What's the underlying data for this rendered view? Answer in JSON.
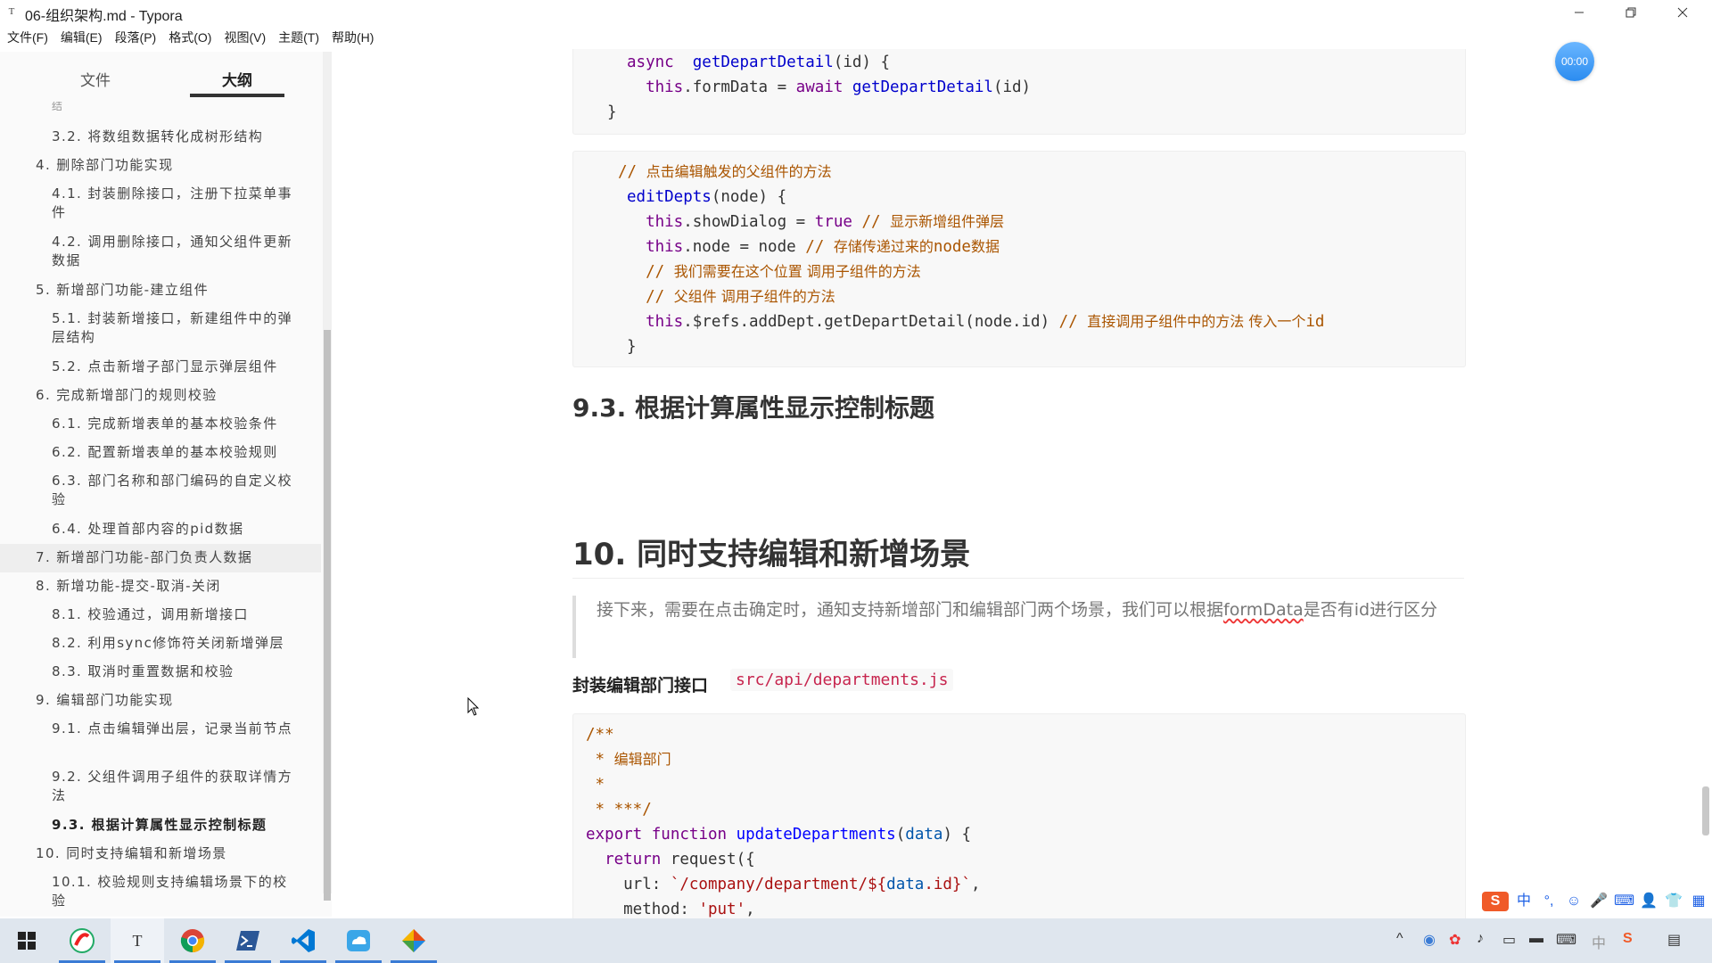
{
  "window": {
    "title": "06-组织架构.md - Typora",
    "app_icon": "T"
  },
  "menu": [
    "文件(F)",
    "编辑(E)",
    "段落(P)",
    "格式(O)",
    "视图(V)",
    "主题(T)",
    "帮助(H)"
  ],
  "sidebar": {
    "tabs": {
      "files": "文件",
      "outline": "大纲"
    },
    "outline": [
      {
        "text": "3.2. 将数组数据转化成树形结构",
        "level": 2
      },
      {
        "text": "4. 删除部门功能实现",
        "level": 1
      },
      {
        "text": "4.1. 封装删除接口，注册下拉菜单事件",
        "level": 2
      },
      {
        "text": "4.2. 调用删除接口，通知父组件更新数据",
        "level": 2
      },
      {
        "text": "5. 新增部门功能-建立组件",
        "level": 1
      },
      {
        "text": "5.1. 封装新增接口，新建组件中的弹层结构",
        "level": 2
      },
      {
        "text": "5.2. 点击新增子部门显示弹层组件",
        "level": 2
      },
      {
        "text": "6. 完成新增部门的规则校验",
        "level": 1
      },
      {
        "text": "6.1. 完成新增表单的基本校验条件",
        "level": 2
      },
      {
        "text": "6.2. 配置新增表单的基本校验规则",
        "level": 2
      },
      {
        "text": "6.3. 部门名称和部门编码的自定义校验",
        "level": 2
      },
      {
        "text": "6.4. 处理首部内容的pid数据",
        "level": 2
      },
      {
        "text": "7. 新增部门功能-部门负责人数据",
        "level": 1,
        "hover": true
      },
      {
        "text": "8. 新增功能-提交-取消-关闭",
        "level": 1
      },
      {
        "text": "8.1. 校验通过，调用新增接口",
        "level": 2
      },
      {
        "text": "8.2. 利用sync修饰符关闭新增弹层",
        "level": 2
      },
      {
        "text": "8.3. 取消时重置数据和校验",
        "level": 2
      },
      {
        "text": "9. 编辑部门功能实现",
        "level": 1
      },
      {
        "text": "9.1. 点击编辑弹出层，记录当前节点",
        "level": 2
      },
      {
        "text": "9.2. 父组件调用子组件的获取详情方法",
        "level": 2
      },
      {
        "text": "9.3. 根据计算属性显示控制标题",
        "level": 2,
        "active": true
      },
      {
        "text": "10. 同时支持编辑和新增场景",
        "level": 1
      },
      {
        "text": "10.1. 校验规则支持编辑场景下的校验",
        "level": 2
      }
    ]
  },
  "code1": [
    [
      [
        "kw",
        "async"
      ],
      [
        "",
        "  "
      ],
      [
        "fn",
        "getDepartDetail"
      ],
      [
        "",
        "(id) {"
      ]
    ],
    [
      [
        "",
        "  "
      ],
      [
        "kw",
        "this"
      ],
      [
        "",
        ".formData = "
      ],
      [
        "kw",
        "await"
      ],
      [
        "",
        ""
      ],
      [
        "fn",
        " getDepartDetail"
      ],
      [
        "",
        "(id)"
      ]
    ],
    [
      [
        "",
        "}"
      ]
    ]
  ],
  "code2": [
    [
      [
        "cm",
        "// "
      ],
      [
        "cmcn",
        "点击编辑触发的父组件的方法"
      ]
    ],
    [
      [
        "",
        ""
      ],
      [
        "fn",
        "editDepts"
      ],
      [
        "",
        "(node) {"
      ]
    ],
    [
      [
        "",
        "  "
      ],
      [
        "kw",
        "this"
      ],
      [
        "",
        ".showDialog = "
      ],
      [
        "kw",
        "true"
      ],
      [
        "cm",
        " // "
      ],
      [
        "cmcn",
        "显示新增组件弹层"
      ]
    ],
    [
      [
        "",
        "  "
      ],
      [
        "kw",
        "this"
      ],
      [
        "",
        ".node = node "
      ],
      [
        "cm",
        "// "
      ],
      [
        "cmcn",
        "存储传递过来的"
      ],
      [
        "cm",
        "node"
      ],
      [
        "cmcn",
        "数据"
      ]
    ],
    [
      [
        "",
        "  "
      ],
      [
        "cm",
        "// "
      ],
      [
        "cmcn",
        "我们需要在这个位置 调用子组件的方法"
      ]
    ],
    [
      [
        "",
        "  "
      ],
      [
        "cm",
        "// "
      ],
      [
        "cmcn",
        "父组件 调用子组件的方法"
      ]
    ],
    [
      [
        "",
        "  "
      ],
      [
        "kw",
        "this"
      ],
      [
        "",
        ".$refs.addDept.getDepartDetail(node.id) "
      ],
      [
        "cm",
        "// "
      ],
      [
        "cmcn",
        "直接调用子组件中的方法 传入一个"
      ],
      [
        "cm",
        "id"
      ]
    ],
    [
      [
        "",
        "}"
      ]
    ]
  ],
  "heading_9_3": "9.3. 根据计算属性显示控制标题",
  "heading_10": "10. 同时支持编辑和新增场景",
  "quote": {
    "before": "接下来，需要在点击确定时，通知支持新增部门和编辑部门两个场景，我们可以根据",
    "underlined": "formData",
    "after": "是否有id进行区分"
  },
  "api_label": "封装编辑部门接口",
  "api_path": "src/api/departments.js",
  "code3": [
    [
      [
        "cm",
        "/**"
      ]
    ],
    [
      [
        "cm",
        " * "
      ],
      [
        "cmcn",
        "编辑部门"
      ]
    ],
    [
      [
        "cm",
        " *"
      ]
    ],
    [
      [
        "cm",
        " * ***/"
      ]
    ],
    [
      [
        "kw",
        "export"
      ],
      [
        "",
        " "
      ],
      [
        "kw",
        "function"
      ],
      [
        "",
        " "
      ],
      [
        "def",
        "updateDepartments"
      ],
      [
        "",
        "("
      ],
      [
        "var",
        "data"
      ],
      [
        "",
        ") {"
      ]
    ],
    [
      [
        "",
        "  "
      ],
      [
        "kw",
        "return"
      ],
      [
        "",
        " request({"
      ]
    ],
    [
      [
        "",
        "    url: "
      ],
      [
        "str",
        "`/company/department/${"
      ],
      [
        "var",
        "data"
      ],
      [
        "str",
        ".id}`"
      ],
      [
        "",
        ","
      ]
    ],
    [
      [
        "",
        "    method: "
      ],
      [
        "str",
        "'put'"
      ],
      [
        "",
        ","
      ]
    ]
  ],
  "timer": "00:00",
  "ime": [
    "中",
    "°,",
    "☺",
    "🎤",
    "⌨",
    "👤",
    "👕",
    "▦"
  ],
  "taskbar": {
    "apps": [
      "start-icon",
      "app-red-icon",
      "typora-icon",
      "chrome-icon",
      "powershell-icon",
      "vscode-icon",
      "cloud-icon",
      "photos-icon"
    ]
  },
  "colors": {
    "accent": "#3a7bd5",
    "code_keyword": "#770088",
    "code_function": "#0000cc",
    "code_comment": "#aa5500",
    "code_string": "#aa1111",
    "inline_code": "#c7254e"
  }
}
